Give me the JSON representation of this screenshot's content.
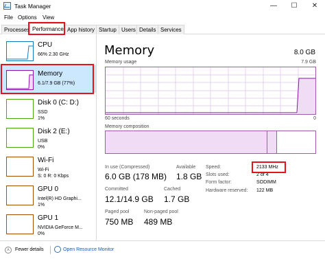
{
  "window": {
    "title": "Task Manager",
    "min_icon": "minimize-icon",
    "max_icon": "maximize-icon",
    "close_icon": "close-icon"
  },
  "menu": [
    "File",
    "Options",
    "View"
  ],
  "tabs": [
    "Processes",
    "Performance",
    "App history",
    "Startup",
    "Users",
    "Details",
    "Services"
  ],
  "sidebar": {
    "items": [
      {
        "name": "CPU",
        "sub1": "66%  2.30 GHz",
        "sub2": "",
        "color": "#117dbb"
      },
      {
        "name": "Memory",
        "sub1": "6.1/7.9 GB (77%)",
        "sub2": "",
        "color": "#8b12ae"
      },
      {
        "name": "Disk 0 (C: D:)",
        "sub1": "SSD",
        "sub2": "1%",
        "color": "#4da60c"
      },
      {
        "name": "Disk 2 (E:)",
        "sub1": "USB",
        "sub2": "0%",
        "color": "#4da60c"
      },
      {
        "name": "Wi-Fi",
        "sub1": "Wi-Fi",
        "sub2": "S: 0  R: 0 Kbps",
        "color": "#a74f01"
      },
      {
        "name": "GPU 0",
        "sub1": "Intel(R) HD Graphi...",
        "sub2": "1%",
        "color": "#a74f01"
      },
      {
        "name": "GPU 1",
        "sub1": "NVIDIA GeForce M...",
        "sub2": "0%",
        "color": "#a74f01"
      }
    ]
  },
  "main": {
    "title": "Memory",
    "total": "8.0 GB",
    "usage_label": "Memory usage",
    "usage_max": "7.9 GB",
    "time_left": "60 seconds",
    "time_right": "0",
    "composition_label": "Memory composition",
    "usage_fraction_end": 0.77,
    "stats": {
      "in_use_label": "In use (Compressed)",
      "in_use_value": "6.0 GB (178 MB)",
      "available_label": "Available",
      "available_value": "1.8 GB",
      "committed_label": "Committed",
      "committed_value": "12.1/14.9 GB",
      "cached_label": "Cached",
      "cached_value": "1.7 GB",
      "paged_label": "Paged pool",
      "paged_value": "750 MB",
      "nonpaged_label": "Non-paged pool",
      "nonpaged_value": "489 MB"
    },
    "details": [
      {
        "label": "Speed:",
        "value": "2133 MHz"
      },
      {
        "label": "Slots used:",
        "value": "2 of 4"
      },
      {
        "label": "Form factor:",
        "value": "SODIMM"
      },
      {
        "label": "Hardware reserved:",
        "value": "122 MB"
      }
    ]
  },
  "footer": {
    "fewer": "Fewer details",
    "link": "Open Resource Monitor"
  },
  "colors": {
    "accent_red": "#e3121b",
    "memory": "#8b12ae",
    "selected": "#cce8ff"
  }
}
